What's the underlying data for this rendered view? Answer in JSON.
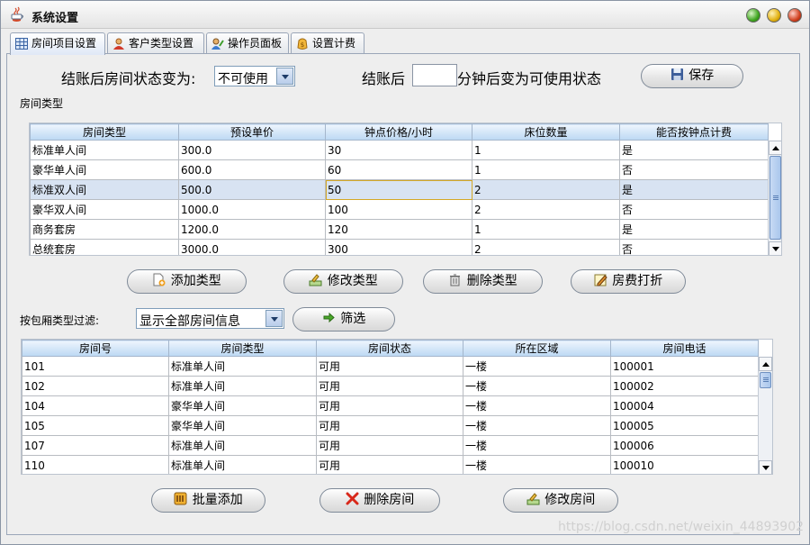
{
  "window": {
    "title": "系统设置"
  },
  "tabs": [
    {
      "label": "房间项目设置",
      "icon": "grid-icon"
    },
    {
      "label": "客户类型设置",
      "icon": "user-icon"
    },
    {
      "label": "操作员面板",
      "icon": "operator-icon"
    },
    {
      "label": "设置计费",
      "icon": "billing-icon"
    }
  ],
  "checkout": {
    "status_label": "结账后房间状态变为:",
    "status_value": "不可使用",
    "minutes_prefix": "结账后",
    "minutes_value": "",
    "minutes_suffix": "分钟后变为可使用状态",
    "save_label": "保存"
  },
  "room_types": {
    "section_label": "房间类型",
    "headers": [
      "房间类型",
      "预设单价",
      "钟点价格/小时",
      "床位数量",
      "能否按钟点计费"
    ],
    "rows": [
      [
        "标准单人间",
        "300.0",
        "30",
        "1",
        "是"
      ],
      [
        "豪华单人间",
        "600.0",
        "60",
        "1",
        "否"
      ],
      [
        "标准双人间",
        "500.0",
        "50",
        "2",
        "是"
      ],
      [
        "豪华双人间",
        "1000.0",
        "100",
        "2",
        "否"
      ],
      [
        "商务套房",
        "1200.0",
        "120",
        "1",
        "是"
      ],
      [
        "总统套房",
        "3000.0",
        "300",
        "2",
        "否"
      ]
    ],
    "buttons": {
      "add": "添加类型",
      "edit": "修改类型",
      "delete": "删除类型",
      "discount": "房费打折"
    }
  },
  "filter": {
    "label": "按包厢类型过滤:",
    "value": "显示全部房间信息",
    "button": "筛选"
  },
  "rooms": {
    "headers": [
      "房间号",
      "房间类型",
      "房间状态",
      "所在区域",
      "房间电话"
    ],
    "rows": [
      [
        "101",
        "标准单人间",
        "可用",
        "一楼",
        "100001"
      ],
      [
        "102",
        "标准单人间",
        "可用",
        "一楼",
        "100002"
      ],
      [
        "104",
        "豪华单人间",
        "可用",
        "一楼",
        "100004"
      ],
      [
        "105",
        "豪华单人间",
        "可用",
        "一楼",
        "100005"
      ],
      [
        "107",
        "标准单人间",
        "可用",
        "一楼",
        "100006"
      ],
      [
        "110",
        "标准单人间",
        "可用",
        "一楼",
        "100010"
      ]
    ],
    "buttons": {
      "batch_add": "批量添加",
      "delete": "删除房间",
      "edit": "修改房间"
    }
  },
  "watermark": "https://blog.csdn.net/weixin_44893902"
}
